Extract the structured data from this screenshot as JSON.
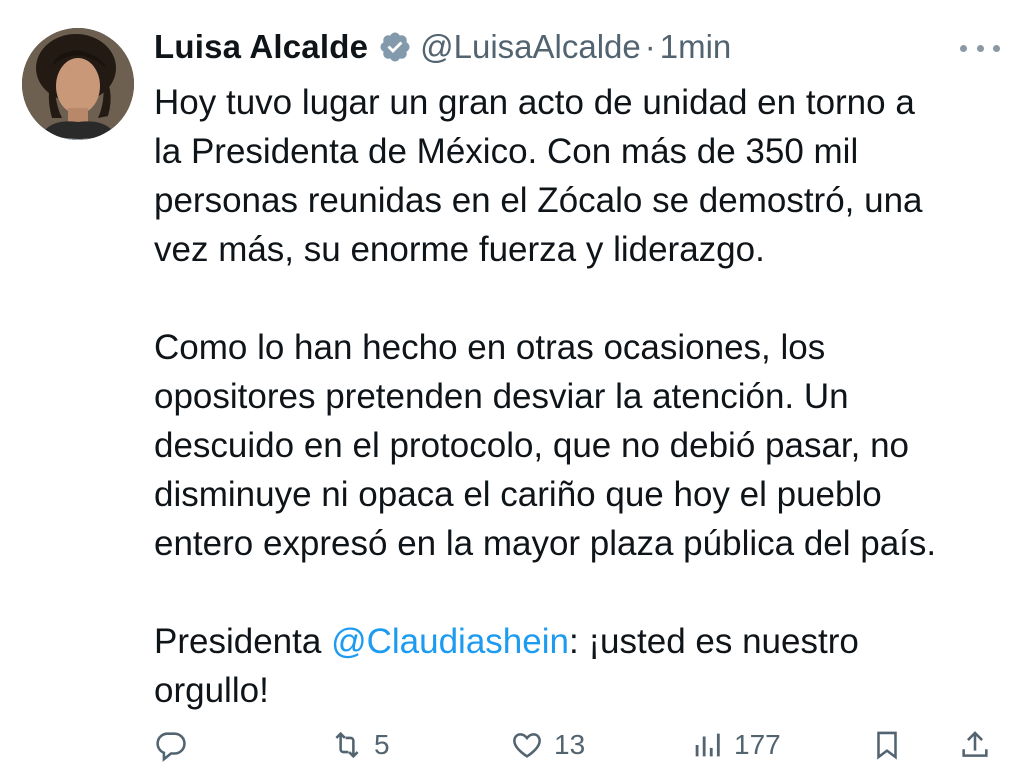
{
  "author": {
    "name": "Luisa Alcalde",
    "handle": "@LuisaAlcalde",
    "separator": "·",
    "time": "1min",
    "verified": true,
    "avatar_icon": "profile-photo"
  },
  "tweet": {
    "p1": [
      "Hoy tuvo lugar un gran acto de unidad en torno a",
      "la Presidenta de México. Con más de 350 mil",
      "personas reunidas en el Zócalo se demostró, una",
      "vez más, su enorme fuerza y liderazgo."
    ],
    "p2": [
      "Como lo han hecho en otras ocasiones, los",
      "opositores pretenden desviar la atención. Un",
      "descuido en el protocolo, que no debió pasar, no",
      "disminuye ni opaca el cariño que hoy el pueblo",
      "entero expresó en la mayor plaza pública del país."
    ],
    "p3": {
      "prefix": "Presidenta ",
      "mention": "@Claudiashein",
      "suffix": ": ¡usted es nuestro",
      "line2": "orgullo!"
    }
  },
  "actions": {
    "reply_icon": "reply-icon",
    "retweets": "5",
    "likes": "13",
    "views": "177",
    "bookmark_icon": "bookmark-icon",
    "share_icon": "share-icon"
  },
  "colors": {
    "text": "#0f1419",
    "muted": "#536471",
    "link": "#1d9bf0",
    "verified_badge": "#829aab"
  }
}
